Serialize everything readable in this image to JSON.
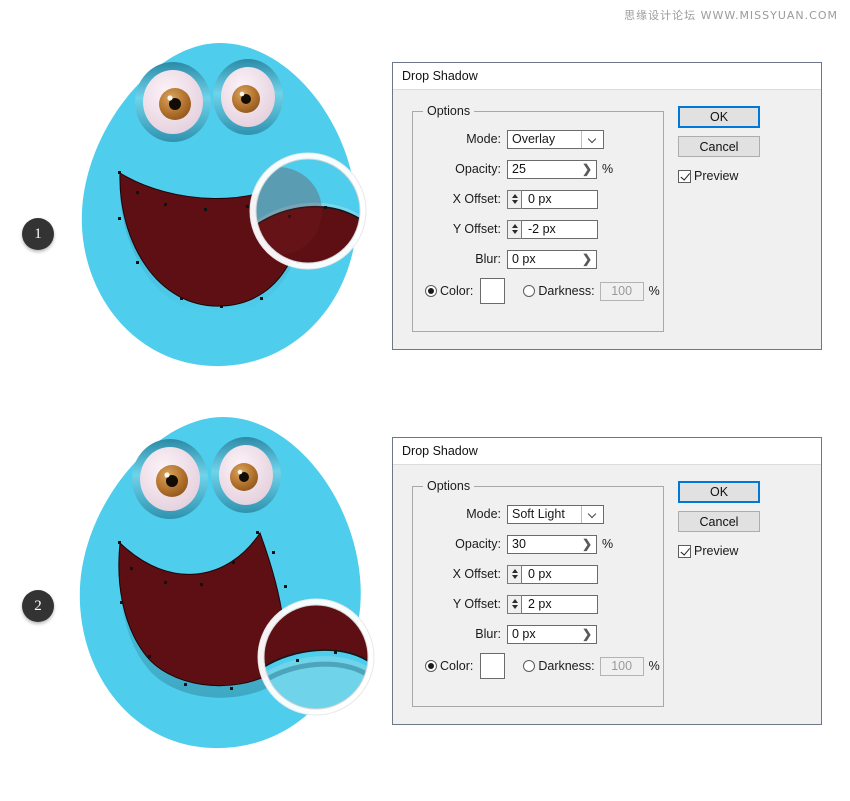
{
  "watermark": "思缘设计论坛  WWW.MISSYUAN.COM",
  "steps": [
    {
      "number": "1"
    },
    {
      "number": "2"
    }
  ],
  "dialogs": [
    {
      "title": "Drop Shadow",
      "group_label": "Options",
      "fields": {
        "mode_label": "Mode:",
        "mode_value": "Overlay",
        "opacity_label": "Opacity:",
        "opacity_value": "25",
        "opacity_unit": "%",
        "xoffset_label": "X Offset:",
        "xoffset_value": "0 px",
        "yoffset_label": "Y Offset:",
        "yoffset_value": "-2 px",
        "blur_label": "Blur:",
        "blur_value": "0 px",
        "color_label": "Color:",
        "color_swatch": "#ffffff",
        "darkness_label": "Darkness:",
        "darkness_value": "100",
        "darkness_unit": "%"
      },
      "buttons": {
        "ok_label": "OK",
        "cancel_label": "Cancel",
        "preview_label": "Preview",
        "preview_checked": true,
        "ok_focus_color": "#0078d7"
      }
    },
    {
      "title": "Drop Shadow",
      "group_label": "Options",
      "fields": {
        "mode_label": "Mode:",
        "mode_value": "Soft Light",
        "opacity_label": "Opacity:",
        "opacity_value": "30",
        "opacity_unit": "%",
        "xoffset_label": "X Offset:",
        "xoffset_value": "0 px",
        "yoffset_label": "Y Offset:",
        "yoffset_value": "2 px",
        "blur_label": "Blur:",
        "blur_value": "0 px",
        "color_label": "Color:",
        "color_swatch": "#ffffff",
        "darkness_label": "Darkness:",
        "darkness_value": "100",
        "darkness_unit": "%"
      },
      "buttons": {
        "ok_label": "OK",
        "cancel_label": "Cancel",
        "preview_label": "Preview",
        "preview_checked": true,
        "ok_focus_color": "#0078d7"
      }
    }
  ],
  "artwork": {
    "character_name": "blue blob monster",
    "colors": {
      "body": "#4ecdec",
      "body_shade": "#3fbfe0",
      "mouth": "#5e0f14",
      "mouth_light": "#6d151b",
      "eye_rim": "#3aa6c4",
      "eye_rim_dark": "#2c8aa6",
      "sclera": "#f4e4ec",
      "iris": "#b3732e",
      "iris_light": "#d4a05e",
      "pupil": "#120c06",
      "magnifier_ring": "#ffffff",
      "shadow": "#2f7f96"
    },
    "magnifier_label": "zoom-loupe"
  }
}
